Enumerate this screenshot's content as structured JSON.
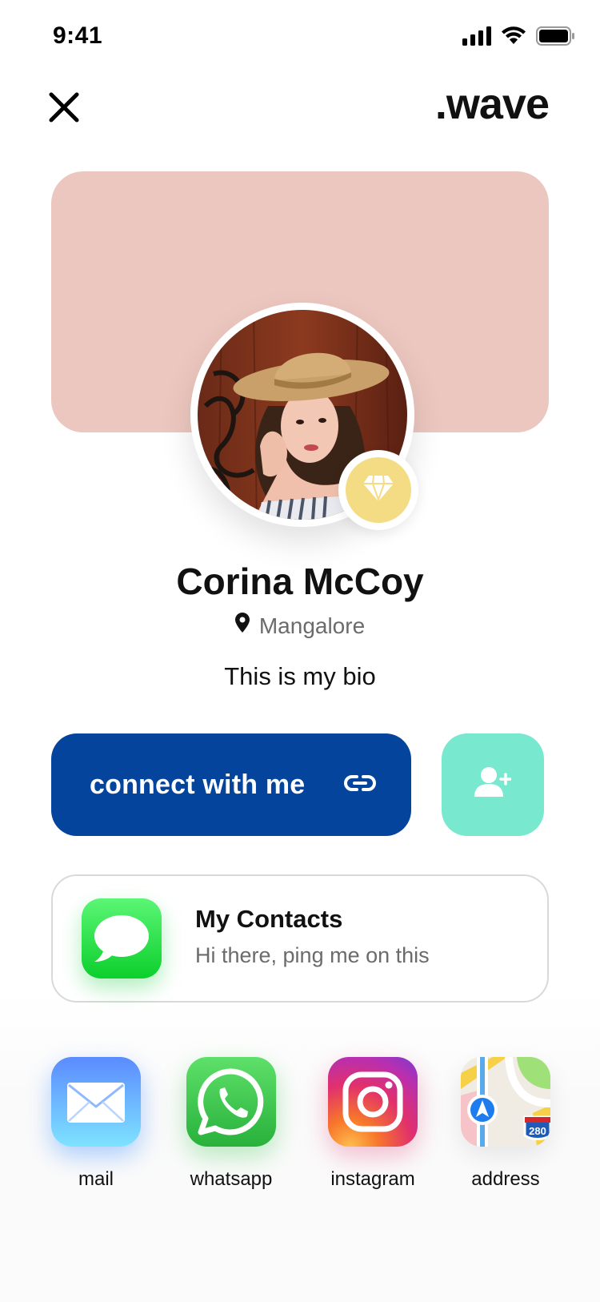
{
  "status_bar": {
    "time": "9:41"
  },
  "header": {
    "brand": ".wave",
    "close_icon": "close-icon"
  },
  "profile": {
    "name": "Corina McCoy",
    "location": "Mangalore",
    "bio": "This is my bio",
    "badge_icon": "diamond-icon",
    "cover_color": "#ecc7bf",
    "badge_color": "#f4dc85"
  },
  "actions": {
    "connect_label": "connect with me",
    "connect_icon": "link-icon",
    "connect_color": "#04449c",
    "add_contact_icon": "add-user-icon",
    "add_contact_color": "#78e8cf"
  },
  "contacts_card": {
    "title": "My Contacts",
    "subtitle": "Hi there, ping me on this",
    "icon": "messages-icon"
  },
  "socials": [
    {
      "label": "mail",
      "icon": "mail-icon"
    },
    {
      "label": "whatsapp",
      "icon": "whatsapp-icon"
    },
    {
      "label": "instagram",
      "icon": "instagram-icon"
    },
    {
      "label": "address",
      "icon": "maps-icon"
    }
  ]
}
